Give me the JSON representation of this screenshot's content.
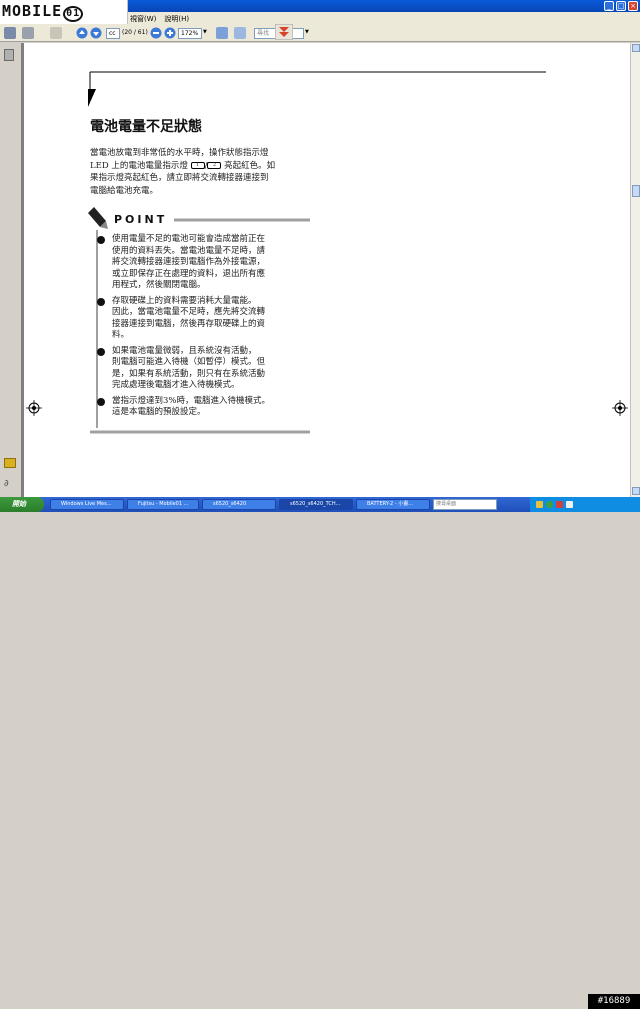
{
  "window": {
    "title_obscured": ""
  },
  "logo": {
    "text": "MOBILE",
    "badge": "01"
  },
  "menubar": {
    "items": [
      "視窗(W)",
      "說明(H)"
    ]
  },
  "toolbar": {
    "page_field": "cc",
    "page_counter": "(20 / 61)",
    "zoom": "172%",
    "search_placeholder": "尋找"
  },
  "document": {
    "heading": "電池電量不足狀態",
    "intro_lines": [
      "當電池放電到非常低的水平時，操作狀態指示燈",
      "LED 上的電池電量指示燈",
      "亮起紅色。如",
      "果指示燈亮起紅色，請立即將交流轉接器連接到",
      "電腦給電池充電。"
    ],
    "point_label": "POINT",
    "bullets": [
      [
        "使用電量不足的電池可能會造成當前正在",
        "使用的資料丟失。當電池電量不足時，請",
        "將交流轉接器連接到電腦作為外接電源，",
        "或立即保存正在處理的資料，退出所有應",
        "用程式，然後關閉電腦。"
      ],
      [
        "存取硬碟上的資料需要消耗大量電能。",
        "因此，當電池電量不足時，應先將交流轉",
        "接器連接到電腦，然後再存取硬碟上的資",
        "料。"
      ],
      [
        "如果電池電量微弱，且系統沒有活動，",
        "則電腦可能進入待機（如暫停）模式。但",
        "是，如果有系統活動，則只有在系統活動",
        "完成處理後電腦才進入待機模式。"
      ],
      [
        "當指示燈達到3%時，電腦進入待機模式。",
        "這是本電腦的預設設定。"
      ]
    ],
    "badge_1": "1",
    "badge_2": "2"
  },
  "taskbar": {
    "start_label": "開始",
    "tasks": [
      {
        "label": "Windows Live Mes...",
        "active": false
      },
      {
        "label": "Fujitsu - Mobile01 ...",
        "active": false
      },
      {
        "label": "s6520_s6420",
        "active": false
      },
      {
        "label": "s6520_s6420_TCH...",
        "active": true
      },
      {
        "label": "BATTERY-2 - 小畫...",
        "active": false
      }
    ],
    "search_placeholder": "搜尋桌面",
    "watermark": "#16889"
  },
  "colors": {
    "accent_red": "#d8432e",
    "xp_blue": "#1f4fb8",
    "start_green": "#2b7d2b"
  }
}
